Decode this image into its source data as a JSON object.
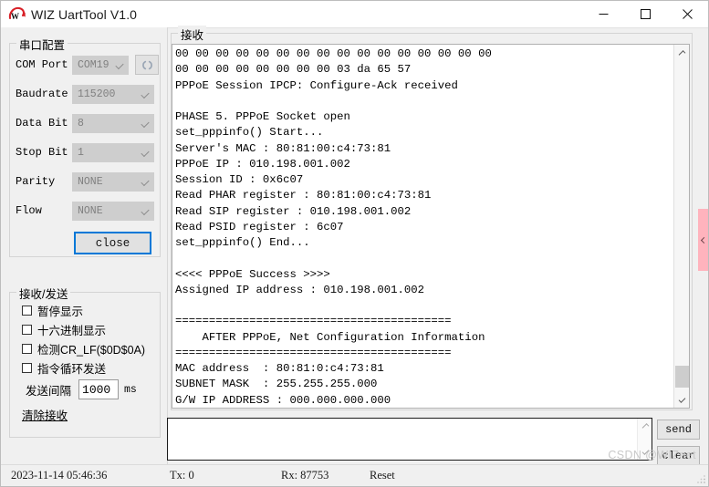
{
  "window": {
    "title": "WIZ UartTool V1.0",
    "logo_icon": "wiznet-w-logo-icon",
    "minimize_label": "—",
    "maximize_label": "☐",
    "close_label": "✕"
  },
  "serial_config": {
    "group_title": "串口配置",
    "fields": [
      {
        "label": "COM Port",
        "value": "COM19"
      },
      {
        "label": "Baudrate",
        "value": "115200"
      },
      {
        "label": "Data Bit",
        "value": "8"
      },
      {
        "label": "Stop Bit",
        "value": "1"
      },
      {
        "label": "Parity",
        "value": "NONE"
      },
      {
        "label": "Flow",
        "value": "NONE"
      }
    ],
    "refresh_icon": "refresh-icon",
    "connect_button": "close"
  },
  "rxtx_options": {
    "group_title": "接收/发送",
    "checkboxes": [
      {
        "label": "暂停显示",
        "checked": false
      },
      {
        "label": "十六进制显示",
        "checked": false
      },
      {
        "label": "检测CR_LF($0D$0A)",
        "checked": false
      },
      {
        "label": "指令循环发送",
        "checked": false
      }
    ],
    "interval_label": "发送间隔",
    "interval_value": "1000",
    "interval_unit": "ms",
    "clear_link": "清除接收"
  },
  "receive": {
    "group_title": "接收",
    "content": "00 00 00 00 00 00 00 00 00 00 00 00 00 00 00 00\n00 00 00 00 00 00 00 00 03 da 65 57\nPPPoE Session IPCP: Configure-Ack received\n\nPHASE 5. PPPoE Socket open\nset_pppinfo() Start...\nServer's MAC : 80:81:00:c4:73:81\nPPPoE IP : 010.198.001.002\nSession ID : 0x6c07\nRead PHAR register : 80:81:00:c4:73:81\nRead SIP register : 010.198.001.002\nRead PSID register : 6c07\nset_pppinfo() End...\n\n<<<< PPPoE Success >>>>\nAssigned IP address : 010.198.001.002\n\n=========================================\n    AFTER PPPoE, Net Configuration Information\n=========================================\nMAC address  : 80:81:0:c4:73:81\nSUBNET MASK  : 255.255.255.000\nG/W IP ADDRESS : 000.000.000.000",
    "scroll_up_icon": "chevron-up-icon",
    "scroll_down_icon": "chevron-down-icon"
  },
  "send": {
    "value": "",
    "send_button": "send",
    "clear_button": "clear",
    "scroll_up_icon": "chevron-up-icon",
    "scroll_down_icon": "chevron-down-icon"
  },
  "statusbar": {
    "datetime": "2023-11-14 05:46:36",
    "tx": "Tx: 0",
    "rx": "Rx: 87753",
    "reset": "Reset"
  },
  "overlay": {
    "watermark": "CSDN @WIZnet",
    "side_tab_icon": "chevron-left-icon"
  }
}
